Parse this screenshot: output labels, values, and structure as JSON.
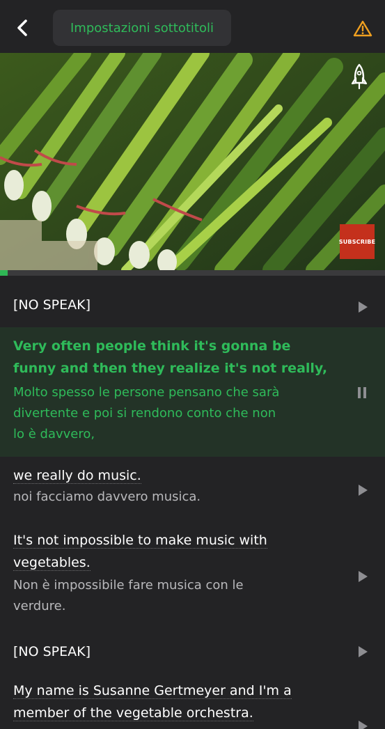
{
  "header": {
    "settings_label": "Impostazioni sottotitoli",
    "accent_color": "#2fbb5a",
    "warning_color": "#f0a020",
    "back_icon": "chevron-left-icon",
    "warning_icon": "warning-triangle-icon"
  },
  "video": {
    "overlay_icon": "rocket-icon",
    "badge_text": "SUBSCRIBE",
    "progress_fraction": 0.02
  },
  "subtitles": [
    {
      "original": "[NO SPEAK]",
      "translation": "",
      "state": "play"
    },
    {
      "original_lines": [
        "Very often people think it's gonna be",
        "funny and then they realize it's not really,"
      ],
      "translation_lines": [
        "Molto spesso le persone pensano che sarà",
        "divertente e poi si rendono conto che non",
        "lo è davvero,"
      ],
      "state": "pause"
    },
    {
      "original_lines": [
        "we really do music."
      ],
      "translation_lines": [
        "noi facciamo davvero musica."
      ],
      "state": "play"
    },
    {
      "original_lines": [
        "It's not impossible to make music with",
        "vegetables."
      ],
      "translation_lines": [
        "Non è impossibile fare musica con le",
        "verdure."
      ],
      "state": "play"
    },
    {
      "original": "[NO SPEAK]",
      "translation": "",
      "state": "play"
    },
    {
      "original_lines": [
        "My name is Susanne Gertmeyer and I'm a",
        "member of the vegetable orchestra."
      ],
      "translation_lines": [],
      "state": "play"
    }
  ]
}
